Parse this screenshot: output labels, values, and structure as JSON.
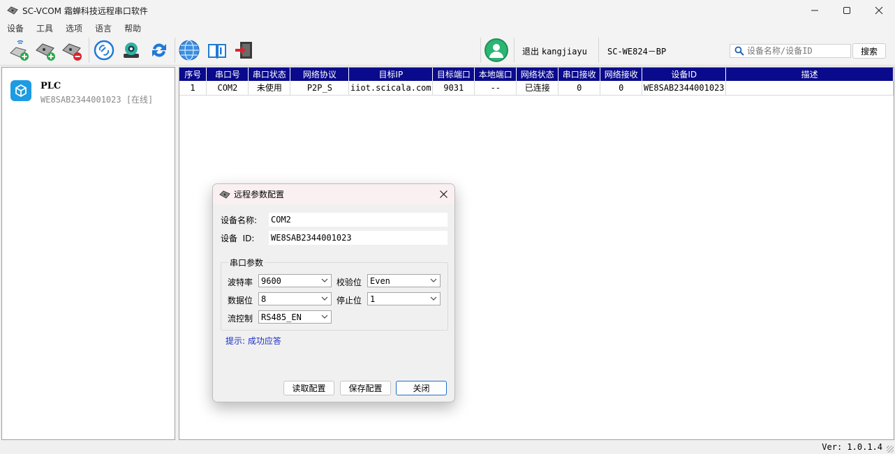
{
  "window": {
    "title": "SC-VCOM 霜蝉科技远程串口软件",
    "controls": [
      "minimize-icon",
      "maximize-icon",
      "close-icon"
    ]
  },
  "menu": [
    "设备",
    "工具",
    "选项",
    "语言",
    "帮助"
  ],
  "toolbar": {
    "buttons": [
      "add-device-icon",
      "add-port-icon",
      "remove-port-icon",
      "link-icon",
      "camera-icon",
      "refresh-icon",
      "globe-icon",
      "manual-book-icon",
      "exit-icon"
    ],
    "logout_label": "退出",
    "username": "kangjiayu",
    "model": "SC-WE824－BP",
    "search_placeholder": "设备名称/设备ID",
    "search_button": "搜索"
  },
  "devices": [
    {
      "name": "PLC",
      "id_status": "WE8SAB2344001023 [在线]"
    }
  ],
  "table": {
    "headers": [
      "序号",
      "串口号",
      "串口状态",
      "网络协议",
      "目标IP",
      "目标端口",
      "本地端口",
      "网络状态",
      "串口接收",
      "网络接收",
      "设备ID",
      "描述"
    ],
    "rows": [
      [
        "1",
        "COM2",
        "未使用",
        "P2P_S",
        "iiot.scicala.com",
        "9031",
        "--",
        "已连接",
        "0",
        "0",
        "WE8SAB2344001023",
        ""
      ]
    ]
  },
  "status": {
    "version": "Ver: 1.0.1.4"
  },
  "dialog": {
    "title": "远程参数配置",
    "device_name_label": "设备名称:",
    "device_name_value": "COM2",
    "device_id_label": "设备  ID:",
    "device_id_value": "WE8SAB2344001023",
    "group_title": "串口参数",
    "baud_label": "波特率",
    "baud_value": "9600",
    "parity_label": "校验位",
    "parity_value": "Even",
    "databits_label": "数据位",
    "databits_value": "8",
    "stopbits_label": "停止位",
    "stopbits_value": "1",
    "flow_label": "流控制",
    "flow_value": "RS485_EN",
    "tip": "提示: 成功应答",
    "read_button": "读取配置",
    "save_button": "保存配置",
    "close_button": "关闭"
  },
  "colors": {
    "table_header_bg": "#0a0a8c",
    "device_icon_bg": "#1e9be2",
    "avatar_bg": "#2bb673",
    "tip_text": "#1c2ec6",
    "primary_button_border": "#1e6fd0"
  }
}
